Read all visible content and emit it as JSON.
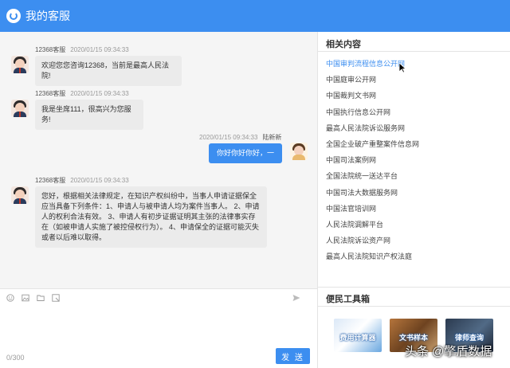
{
  "header": {
    "title": "我的客服"
  },
  "chat": {
    "messages": [
      {
        "sender": "12368客服",
        "time": "2020/01/15 09:34:33",
        "text": "欢迎您您咨询12368，当前是最高人民法院!"
      },
      {
        "sender": "12368客服",
        "time": "2020/01/15 09:34:33",
        "text": "我是坐席111，很高兴为您服务!"
      },
      {
        "sender": "陆新新",
        "time": "2020/01/15 09:34:33",
        "text": "你好你好你好，一"
      },
      {
        "sender": "12368客服",
        "time": "2020/01/15 09:34:33",
        "text": "您好，根据相关法律规定，在知识产权纠纷中，当事人申请证据保全应当具备下列条件：1、申请人与被申请人均为案件当事人。 2、申请人的权利合法有效。 3、申请人有初步证据证明其主张的法律事实存在（如被申请人实施了被控侵权行为）。 4、申请保全的证据可能灭失或者以后难以取得。"
      }
    ]
  },
  "composer": {
    "counter": "0/300",
    "send_label": "发 送"
  },
  "related": {
    "title": "相关内容",
    "links": [
      "中国审判流程信息公开网",
      "中国庭审公开网",
      "中国裁判文书网",
      "中国执行信息公开网",
      "最高人民法院诉讼服务网",
      "全国企业破产重整案件信息网",
      "中国司法案例网",
      "全国法院统一送达平台",
      "中国司法大数据服务网",
      "中国法官培训网",
      "人民法院调解平台",
      "人民法院诉讼资产网",
      "最高人民法院知识产权法庭"
    ]
  },
  "toolbox": {
    "title": "便民工具箱",
    "cards": [
      "费用计算器",
      "文书样本",
      "律师查询"
    ]
  },
  "watermark": "头条 @擎盾数据",
  "colors": {
    "accent": "#3c8ef0"
  }
}
